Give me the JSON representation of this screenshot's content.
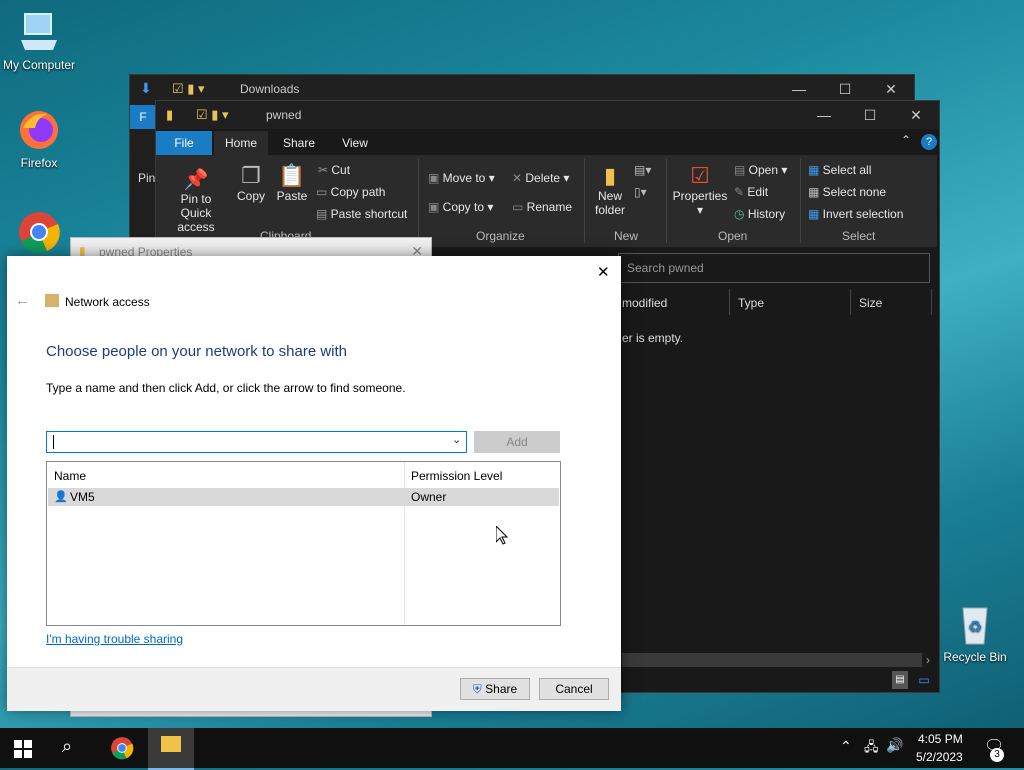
{
  "desktop": {
    "icons": [
      {
        "label": "My Computer",
        "icon": "computer-icon"
      },
      {
        "label": "Firefox",
        "icon": "firefox-icon"
      },
      {
        "label": "",
        "icon": "chrome-icon"
      },
      {
        "label": "Recycle Bin",
        "icon": "recycle-bin-icon"
      }
    ]
  },
  "downloads_window": {
    "title": "Downloads",
    "tab_partial": "F",
    "pin_partial": "Pin"
  },
  "pwned_window": {
    "title": "pwned",
    "tabs": [
      "File",
      "Home",
      "Share",
      "View"
    ],
    "clipboard": {
      "pin": "Pin to Quick access",
      "copy": "Copy",
      "paste": "Paste",
      "cut": "Cut",
      "copy_path": "Copy path",
      "paste_shortcut": "Paste shortcut",
      "group": "Clipboard"
    },
    "organize": {
      "move_to": "Move to",
      "copy_to": "Copy to",
      "delete": "Delete",
      "rename": "Rename",
      "group": "Organize"
    },
    "new": {
      "new_folder": "New folder",
      "group": "New"
    },
    "open": {
      "properties": "Properties",
      "open": "Open",
      "edit": "Edit",
      "history": "History",
      "group": "Open"
    },
    "select": {
      "select_all": "Select all",
      "select_none": "Select none",
      "invert": "Invert selection",
      "group": "Select"
    },
    "search_placeholder": "Search pwned",
    "columns": [
      "modified",
      "Type",
      "Size"
    ],
    "empty_text": "er is empty."
  },
  "properties_window": {
    "title": "pwned Properties"
  },
  "dialog": {
    "header": "Network access",
    "heading": "Choose people on your network to share with",
    "instruction": "Type a name and then click Add, or click the arrow to find someone.",
    "input_value": "",
    "add_label": "Add",
    "columns": [
      "Name",
      "Permission Level"
    ],
    "rows": [
      {
        "name": "VM5",
        "permission": "Owner"
      }
    ],
    "trouble_link": "I'm having trouble sharing",
    "share_label": "Share",
    "cancel_label": "Cancel"
  },
  "taskbar": {
    "time": "4:05 PM",
    "date": "5/2/2023",
    "notification_count": "3"
  }
}
